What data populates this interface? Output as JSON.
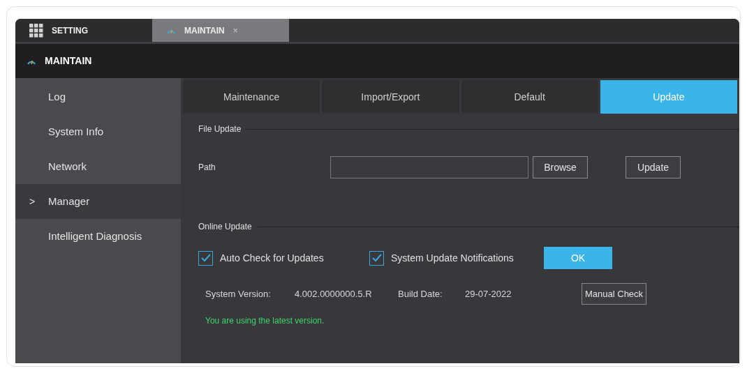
{
  "top_tabs": [
    {
      "label": "SETTING",
      "kind": "home",
      "selected": false
    },
    {
      "label": "MAINTAIN",
      "kind": "page",
      "selected": true,
      "close": "×"
    }
  ],
  "header": {
    "title": "MAINTAIN"
  },
  "sidebar": {
    "items": [
      {
        "label": "Log",
        "selected": false
      },
      {
        "label": "System Info",
        "selected": false
      },
      {
        "label": "Network",
        "selected": false
      },
      {
        "label": "Manager",
        "selected": true,
        "marker": ">"
      },
      {
        "label": "Intelligent Diagnosis",
        "selected": false
      }
    ]
  },
  "tabs": [
    {
      "label": "Maintenance",
      "selected": false
    },
    {
      "label": "Import/Export",
      "selected": false
    },
    {
      "label": "Default",
      "selected": false
    },
    {
      "label": "Update",
      "selected": true
    }
  ],
  "file_update": {
    "legend": "File Update",
    "path_label": "Path",
    "browse": "Browse",
    "update": "Update"
  },
  "online_update": {
    "legend": "Online Update",
    "checkboxes": [
      {
        "label": "Auto Check for Updates",
        "checked": true
      },
      {
        "label": "System Update Notifications",
        "checked": true
      }
    ],
    "ok": "OK",
    "version_label": "System Version:",
    "version": "4.002.0000000.5.R",
    "date_label": "Build Date:",
    "date": "29-07-2022",
    "manual_check": "Manual Check",
    "status": "You are using the latest version."
  }
}
